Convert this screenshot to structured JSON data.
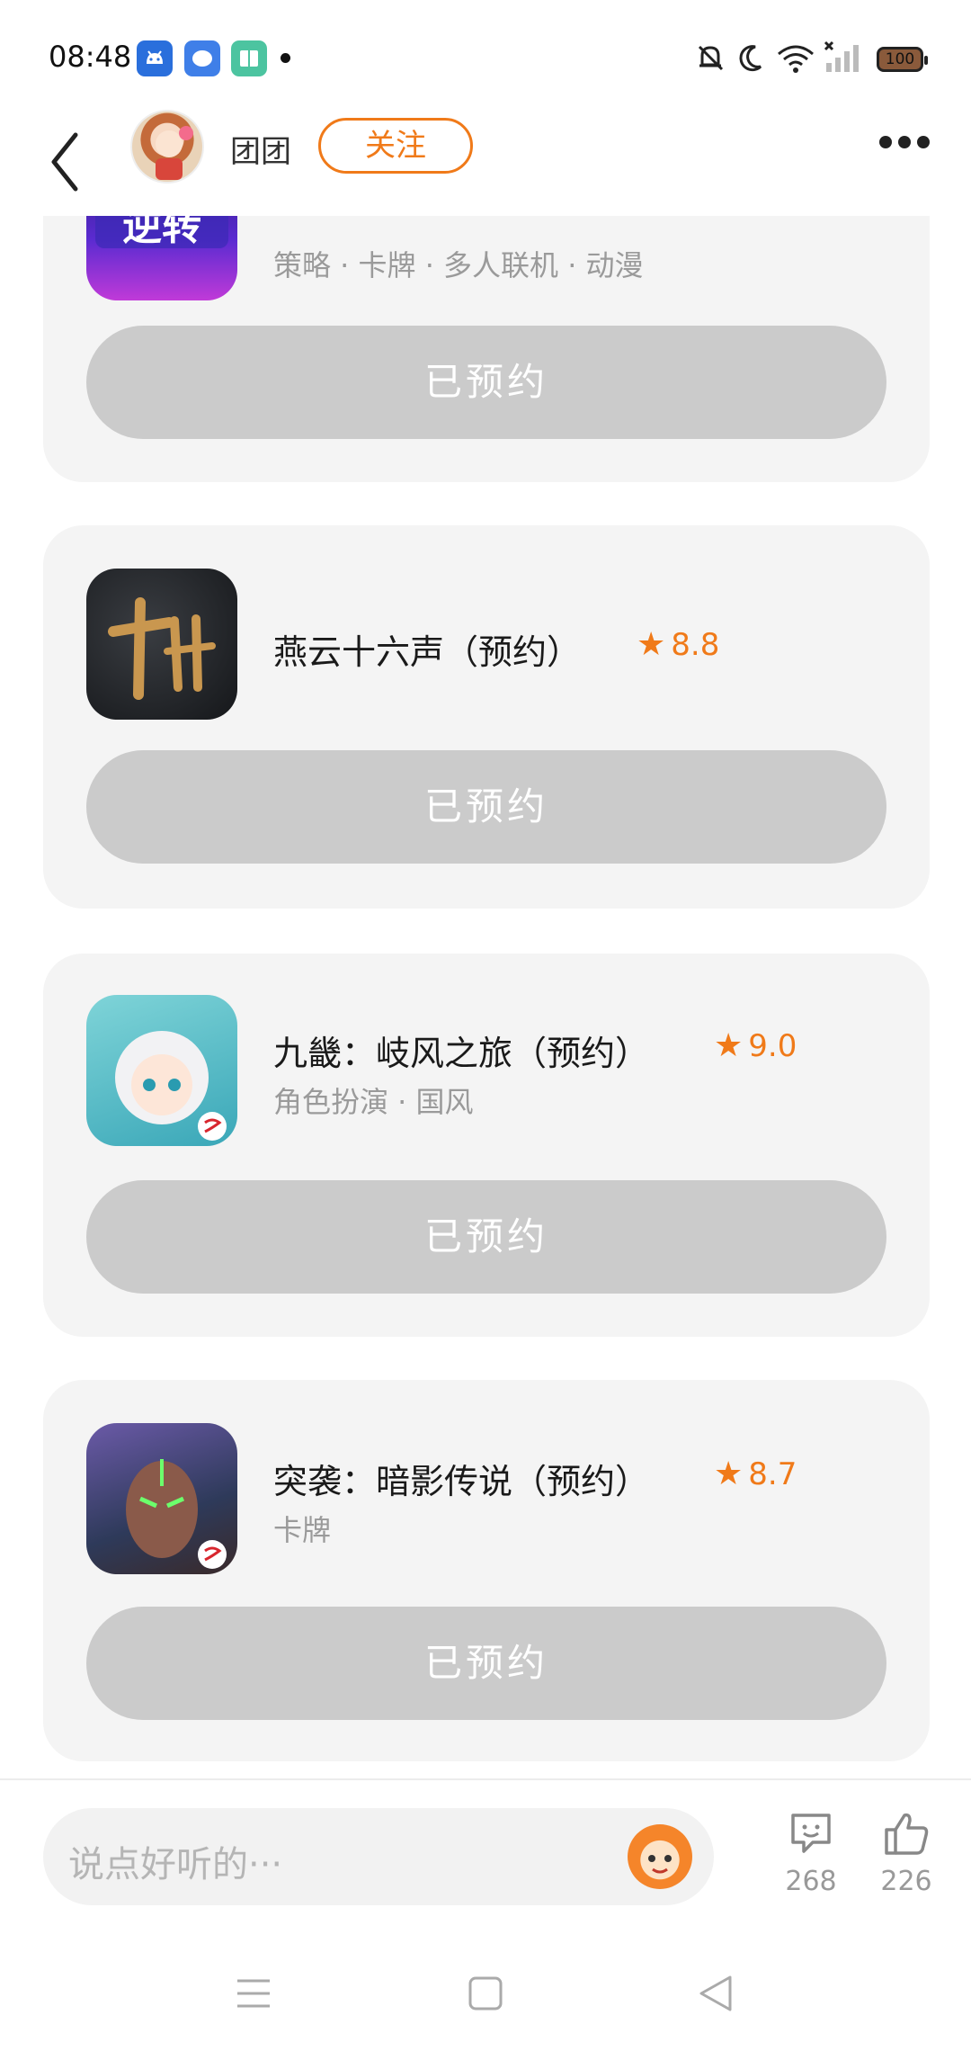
{
  "status_bar": {
    "time": "08:48",
    "battery": "100",
    "icons": [
      "android-icon",
      "message-app-icon",
      "book-app-icon",
      "notification-dot",
      "mute-bell-icon",
      "moon-icon",
      "wifi-icon",
      "signal-icon",
      "battery-icon"
    ]
  },
  "header": {
    "username": "团团",
    "follow_label": "关注"
  },
  "games": [
    {
      "title": "",
      "rating": "",
      "tags": "策略 · 卡牌 · 多人联机 · 动漫",
      "button": "已预约"
    },
    {
      "title": "燕云十六声（预约）",
      "rating": "8.8",
      "tags": "",
      "button": "已预约"
    },
    {
      "title": "九畿：岐风之旅（预约）",
      "rating": "9.0",
      "tags": "角色扮演 · 国风",
      "button": "已预约"
    },
    {
      "title": "突袭：暗影传说（预约）",
      "rating": "8.7",
      "tags": "卡牌",
      "button": "已预约"
    }
  ],
  "bottom_bar": {
    "comment_placeholder": "说点好听的···",
    "comment_count": "268",
    "like_count": "226"
  },
  "colors": {
    "accent": "#f07a19",
    "card_bg": "#f4f4f4",
    "button_bg": "#cbcbcb"
  }
}
